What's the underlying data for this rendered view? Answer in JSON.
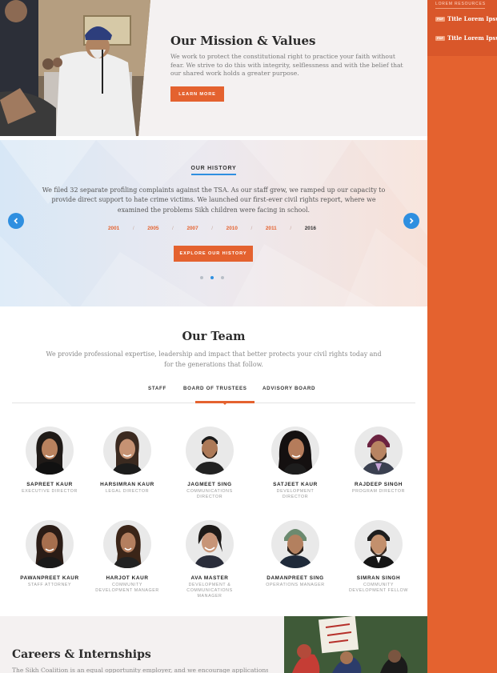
{
  "sidebar": {
    "heading": "LOREM RESOURCES",
    "items": [
      {
        "badge": "PDF",
        "title": "Title Lorem Ipsum"
      },
      {
        "badge": "PDF",
        "title": "Title Lorem Ipsum"
      }
    ]
  },
  "mission": {
    "title": "Our Mission & Values",
    "text": "We work to protect the constitutional right to practice your faith without fear. We strive to do this with integrity, selflessness and with the belief that our shared work holds a greater purpose.",
    "button": "LEARN MORE"
  },
  "history": {
    "label": "OUR HISTORY",
    "text": "We filed 32 separate profiling complaints against the TSA. As our staff grew, we ramped up our capacity to provide direct support to hate crime victims. We launched our first-ever civil rights report, where we examined the problems Sikh children were facing in school.",
    "years": [
      "2001",
      "2005",
      "2007",
      "2010",
      "2011",
      "2016"
    ],
    "active_year": "2016",
    "separator": "/",
    "button": "EXPLORE OUR HISTORY",
    "slides_total": 3,
    "active_slide": 2
  },
  "team": {
    "title": "Our Team",
    "description": "We provide professional expertise, leadership and impact that better protects your civil rights today and for the generations that follow.",
    "tabs": [
      "STAFF",
      "BOARD OF TRUSTEES",
      "ADVISORY BOARD"
    ],
    "active_tab": "BOARD OF TRUSTEES",
    "members": [
      {
        "name": "SAPREET KAUR",
        "role": "EXECUTIVE DIRECTOR"
      },
      {
        "name": "HARSIMRAN KAUR",
        "role": "LEGAL DIRECTOR"
      },
      {
        "name": "JAGMEET SING",
        "role": "COMMUNICATIONS DIRECTOR"
      },
      {
        "name": "SATJEET KAUR",
        "role": "DEVELOPMENT DIRECTOR"
      },
      {
        "name": "RAJDEEP SINGH",
        "role": "PROGRAM DIRECTOR"
      },
      {
        "name": "PAWANPREET KAUR",
        "role": "STAFF ATTORNEY"
      },
      {
        "name": "HARJOT KAUR",
        "role": "COMMUNITY DEVELOPMENT MANAGER"
      },
      {
        "name": "AVA MASTER",
        "role": "DEVELOPMENT & COMMUNICATIONS MANAGER"
      },
      {
        "name": "DAMANPREET SING",
        "role": "OPERATIONS MANAGER"
      },
      {
        "name": "SIMRAN SINGH",
        "role": "COMMUNITY DEVELOPMENT FELLOW"
      }
    ]
  },
  "careers": {
    "title": "Careers & Internships",
    "text": "The Sikh Coalition is an equal opportunity employer, and we encourage applications"
  },
  "colors": {
    "accent": "#e4622f",
    "blue": "#2f8fe0",
    "heading": "#2b2b2b"
  },
  "icons": {
    "prev": "chevron-left-icon",
    "next": "chevron-right-icon"
  }
}
